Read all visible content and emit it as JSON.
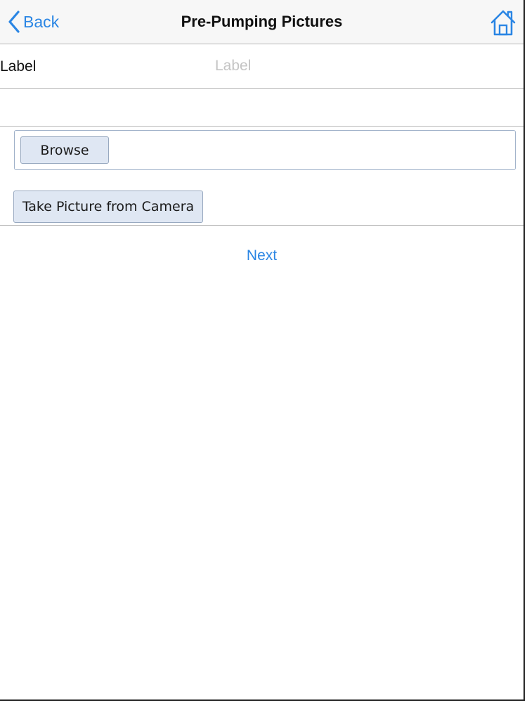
{
  "navbar": {
    "back_label": "Back",
    "title": "Pre-Pumping Pictures",
    "back_icon": "chevron-left-icon",
    "home_icon": "home-icon"
  },
  "form": {
    "label_text": "Label",
    "label_placeholder": "Label",
    "label_value": ""
  },
  "upload": {
    "browse_label": "Browse",
    "camera_label": "Take Picture from Camera"
  },
  "footer": {
    "next_label": "Next"
  },
  "colors": {
    "accent": "#2b86e4",
    "button_bg": "#dfe7f3",
    "divider": "#b8b8b8"
  }
}
